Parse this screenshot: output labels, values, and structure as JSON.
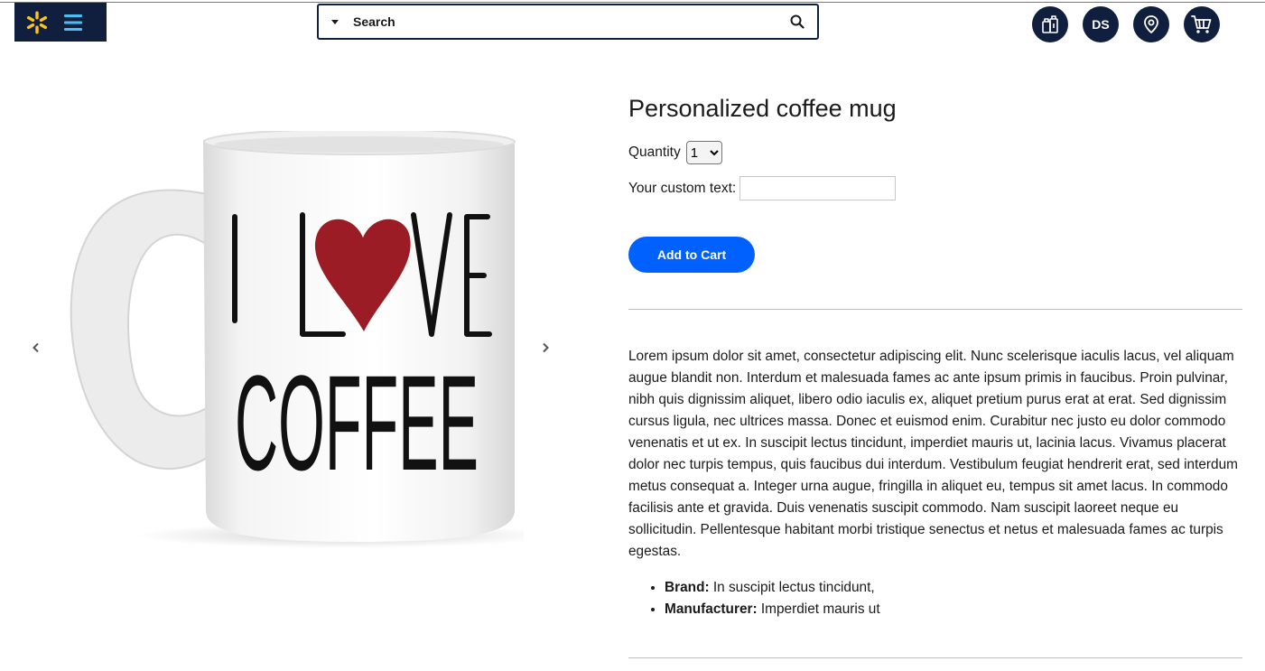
{
  "header": {
    "search": {
      "placeholder": "Search"
    },
    "icons": [
      "reorder-icon",
      "account-icon",
      "location-pin-icon",
      "cart-icon"
    ],
    "account_initials": "DS",
    "colors": {
      "navy": "#0f1f3d",
      "spark": "#ffc220",
      "menu": "#4dbdf5"
    }
  },
  "product": {
    "title": "Personalized coffee mug",
    "quantity_label": "Quantity",
    "quantity_value": "1",
    "quantity_options": [
      "1"
    ],
    "custom_text_label": "Your custom text:",
    "custom_text_value": "",
    "add_to_cart_label": "Add to Cart",
    "button_color": "#0061ff",
    "image": {
      "line1_left": "I L",
      "line1_right": "VE",
      "line2": "COFFEE",
      "heart_color": "#9b1c24"
    },
    "description": "Lorem ipsum dolor sit amet, consectetur adipiscing elit. Nunc scelerisque iaculis lacus, vel aliquam augue blandit non. Interdum et malesuada fames ac ante ipsum primis in faucibus. Proin pulvinar, nibh quis dignissim aliquet, libero odio iaculis ex, aliquet pretium purus erat at erat. Sed dignissim cursus ligula, nec ultrices massa. Donec et euismod enim. Curabitur nec justo eu dolor commodo venenatis et ut ex. In suscipit lectus tincidunt, imperdiet mauris ut, lacinia lacus. Vivamus placerat dolor nec turpis tempus, quis faucibus dui interdum. Vestibulum feugiat hendrerit erat, sed interdum metus consequat a. Integer urna augue, fringilla in aliquet eu, tempus sit amet lacus. In commodo facilisis ante et gravida. Duis venenatis suscipit commodo. Nam suscipit laoreet neque eu sollicitudin. Pellentesque habitant morbi tristique senectus et netus et malesuada fames ac turpis egestas.",
    "specs": [
      {
        "label": "Brand:",
        "value": " In suscipit lectus tincidunt,"
      },
      {
        "label": "Manufacturer:",
        "value": " Imperdiet mauris ut"
      }
    ]
  }
}
